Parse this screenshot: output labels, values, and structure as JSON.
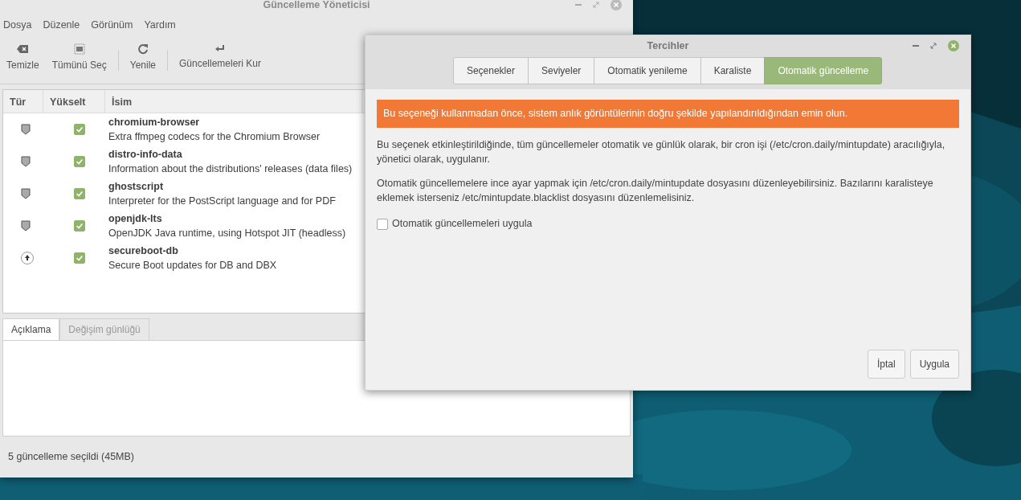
{
  "main_window": {
    "title": "Güncelleme Yöneticisi",
    "menu": [
      "Dosya",
      "Düzenle",
      "Görünüm",
      "Yardım"
    ],
    "toolbar": [
      {
        "kind": "clear",
        "label": "Temizle"
      },
      {
        "kind": "select",
        "label": "Tümünü Seç"
      },
      {
        "kind": "separator"
      },
      {
        "kind": "refresh",
        "label": "Yenile"
      },
      {
        "kind": "separator"
      },
      {
        "kind": "install",
        "label": "Güncellemeleri Kur"
      }
    ],
    "table": {
      "columns": [
        "Tür",
        "Yükselt",
        "İsim"
      ],
      "rows": [
        {
          "kind": "security",
          "checked": true,
          "name": "chromium-browser",
          "description": "Extra ffmpeg codecs for the Chromium Browser"
        },
        {
          "kind": "security",
          "checked": true,
          "name": "distro-info-data",
          "description": "Information about the distributions' releases (data files)"
        },
        {
          "kind": "security",
          "checked": true,
          "name": "ghostscript",
          "description": "Interpreter for the PostScript language and for PDF"
        },
        {
          "kind": "security",
          "checked": true,
          "name": "openjdk-lts",
          "description": "OpenJDK Java runtime, using Hotspot JIT (headless)"
        },
        {
          "kind": "upgrade",
          "checked": true,
          "name": "secureboot-db",
          "description": "Secure Boot updates for DB and DBX"
        }
      ]
    },
    "info_tabs": [
      {
        "label": "Açıklama",
        "selected": true
      },
      {
        "label": "Değişim günlüğü",
        "selected": false
      }
    ],
    "status_bar": "5 güncelleme seçildi (45MB)"
  },
  "dialog": {
    "title": "Tercihler",
    "tabs": [
      {
        "label": "Seçenekler",
        "selected": false
      },
      {
        "label": "Seviyeler",
        "selected": false
      },
      {
        "label": "Otomatik yenileme",
        "selected": false
      },
      {
        "label": "Karaliste",
        "selected": false
      },
      {
        "label": "Otomatik güncelleme",
        "selected": true
      }
    ],
    "warning": "Bu seçeneği kullanmadan önce, sistem anlık görüntülerinin doğru şekilde yapılandırıldığından emin olun.",
    "paragraphs": [
      "Bu seçenek etkinleştirildiğinde, tüm güncellemeler otomatik ve günlük olarak, bir cron işi (/etc/cron.daily/mintupdate) aracılığıyla, yönetici olarak, uygulanır.",
      "Otomatik güncellemelere ince ayar yapmak için /etc/cron.daily/mintupdate dosyasını düzenleyebilirsiniz. Bazılarını karalisteye eklemek isterseniz /etc/mintupdate.blacklist dosyasını düzenlemelisiniz."
    ],
    "checkbox": {
      "label": "Otomatik güncellemeleri uygula",
      "checked": false
    },
    "buttons": [
      "İptal",
      "Uygula"
    ]
  }
}
